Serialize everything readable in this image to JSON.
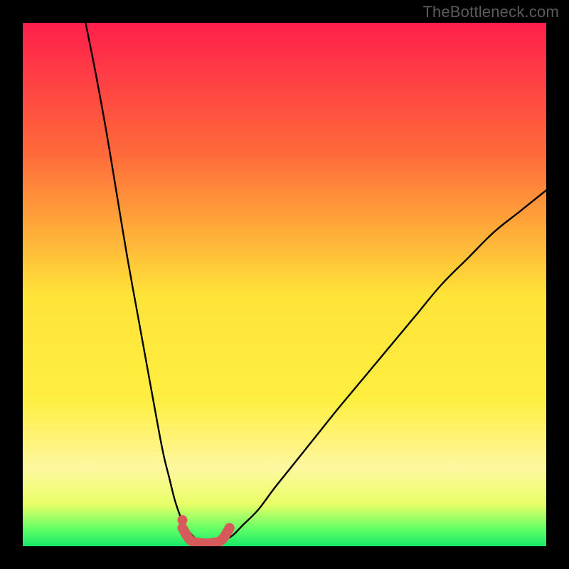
{
  "watermark": "TheBottleneck.com",
  "colors": {
    "frame": "#000000",
    "gradient_top": "#ff1f4c",
    "gradient_mid_upper": "#ff843a",
    "gradient_mid": "#ffe338",
    "gradient_lower": "#fff7a0",
    "gradient_band": "#e8ff66",
    "gradient_bottom": "#17e86a",
    "curve": "#000000",
    "highlight": "#d75a5a",
    "highlight_dot": "#d75a5a"
  },
  "chart_data": {
    "type": "line",
    "title": "",
    "xlabel": "",
    "ylabel": "",
    "xlim": [
      0,
      100
    ],
    "ylim": [
      0,
      100
    ],
    "series": [
      {
        "name": "curve-left",
        "x": [
          12,
          14,
          16,
          18,
          20,
          22,
          24,
          26,
          27,
          28,
          29,
          30,
          31,
          32,
          33,
          34
        ],
        "values": [
          100,
          90,
          79,
          67,
          55,
          44,
          33,
          22,
          17,
          13,
          9,
          6,
          4,
          2.5,
          1.5,
          1
        ]
      },
      {
        "name": "curve-right",
        "x": [
          38,
          40,
          42,
          45,
          48,
          52,
          56,
          60,
          65,
          70,
          75,
          80,
          85,
          90,
          95,
          100
        ],
        "values": [
          1,
          2,
          4,
          7,
          11,
          16,
          21,
          26,
          32,
          38,
          44,
          50,
          55,
          60,
          64,
          68
        ]
      },
      {
        "name": "optimal-band",
        "x": [
          30.5,
          32,
          34,
          36,
          38,
          39.5
        ],
        "values": [
          3.5,
          1.2,
          0.6,
          0.6,
          1.2,
          3.5
        ]
      }
    ],
    "annotations": [
      {
        "name": "highlight-dot",
        "x": 30.5,
        "y": 5
      }
    ],
    "optimal_range": [
      30,
      40
    ]
  }
}
